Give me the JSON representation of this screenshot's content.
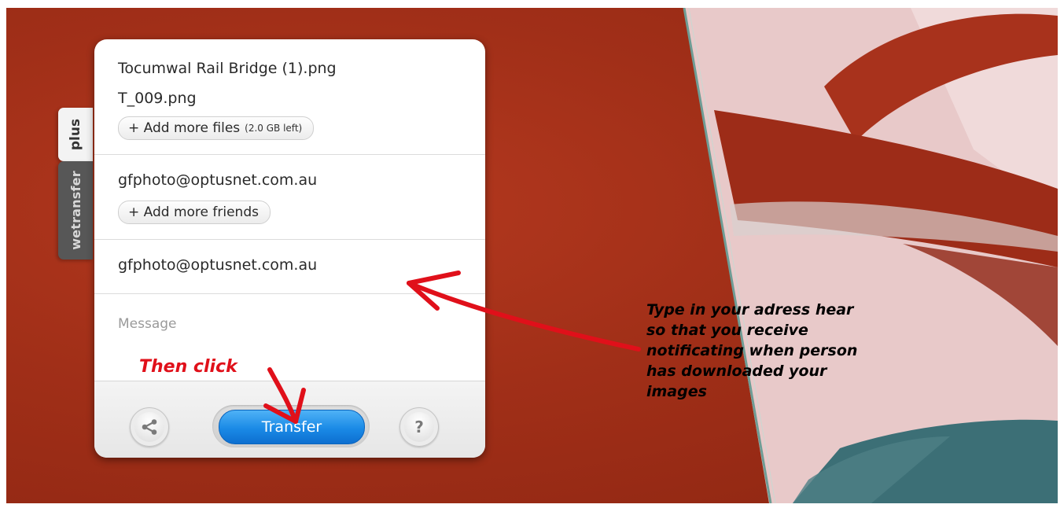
{
  "tabs": {
    "plus": "plus",
    "wetransfer": "wetransfer"
  },
  "files": {
    "items": [
      "Tocumwal Rail Bridge (1).png",
      "T_009.png"
    ],
    "add_label": "+ Add more files",
    "space_left": "(2.0 GB left)"
  },
  "friends": {
    "items": [
      "gfphoto@optusnet.com.au"
    ],
    "add_label": "+ Add more friends"
  },
  "sender_email": "gfphoto@optusnet.com.au",
  "message_placeholder": "Message",
  "footer": {
    "transfer_label": "Transfer",
    "help_label": "?",
    "share_icon": "share-icon"
  },
  "annotations": {
    "then_click": "Then click",
    "note_lines": [
      "Type in your adress hear",
      "so that you receive",
      "notificating when person",
      "has downloaded your",
      "images"
    ],
    "arrow_color": "#e0101a"
  },
  "colors": {
    "background_red": "#a12f18",
    "transfer_blue": "#1a8ae6"
  }
}
